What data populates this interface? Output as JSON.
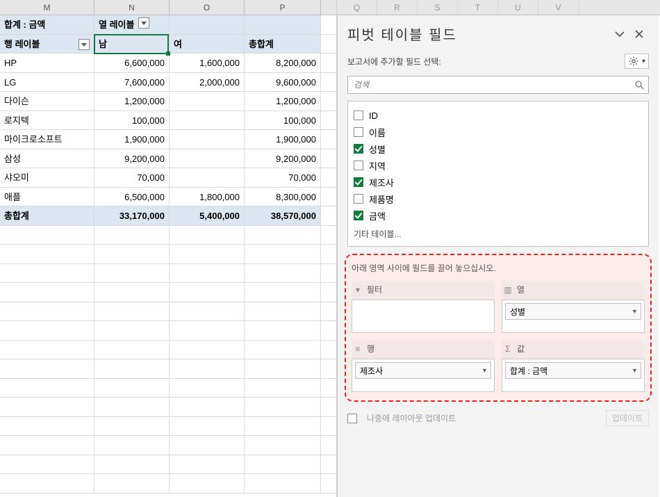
{
  "columns": {
    "M": "M",
    "N": "N",
    "O": "O",
    "P": "P",
    "Q": "Q",
    "R": "R",
    "S": "S",
    "T": "T",
    "U": "U",
    "V": "V"
  },
  "pivot": {
    "corner_label": "합계 : 금액",
    "col_field_label": "열 레이블",
    "row_field_label": "행 레이블",
    "col_headers": {
      "male": "남",
      "female": "여",
      "total": "총합계"
    },
    "rows": [
      {
        "label": "HP",
        "male": "6,600,000",
        "female": "1,600,000",
        "total": "8,200,000"
      },
      {
        "label": "LG",
        "male": "7,600,000",
        "female": "2,000,000",
        "total": "9,600,000"
      },
      {
        "label": "다이슨",
        "male": "1,200,000",
        "female": "",
        "total": "1,200,000"
      },
      {
        "label": "로지텍",
        "male": "100,000",
        "female": "",
        "total": "100,000"
      },
      {
        "label": "마이크로소프트",
        "male": "1,900,000",
        "female": "",
        "total": "1,900,000"
      },
      {
        "label": "삼성",
        "male": "9,200,000",
        "female": "",
        "total": "9,200,000"
      },
      {
        "label": "샤오미",
        "male": "70,000",
        "female": "",
        "total": "70,000"
      },
      {
        "label": "애플",
        "male": "6,500,000",
        "female": "1,800,000",
        "total": "8,300,000"
      }
    ],
    "grand_total": {
      "label": "총합계",
      "male": "33,170,000",
      "female": "5,400,000",
      "total": "38,570,000"
    }
  },
  "pane": {
    "title": "피벗 테이블 필드",
    "subtitle": "보고서에 추가할 필드 선택:",
    "search_placeholder": "검색",
    "fields": [
      {
        "label": "ID",
        "checked": false
      },
      {
        "label": "이름",
        "checked": false
      },
      {
        "label": "성별",
        "checked": true
      },
      {
        "label": "지역",
        "checked": false
      },
      {
        "label": "제조사",
        "checked": true
      },
      {
        "label": "제품명",
        "checked": false
      },
      {
        "label": "금액",
        "checked": true
      }
    ],
    "other_tables": "기타 테이블...",
    "drop_instruction": "아래 영역 사이에 필드를 끌어 놓으십시오.",
    "areas": {
      "filters": {
        "title": "필터",
        "items": []
      },
      "columns": {
        "title": "열",
        "items": [
          "성별"
        ]
      },
      "rows": {
        "title": "행",
        "items": [
          "제조사"
        ]
      },
      "values": {
        "title": "값",
        "items": [
          "합계 : 금액"
        ]
      }
    },
    "defer_label": "나중에 레이아웃 업데이트",
    "update_btn": "업데이트"
  },
  "chart_data": {
    "type": "table",
    "title": "합계 : 금액",
    "row_field": "제조사",
    "col_field": "성별",
    "columns": [
      "남",
      "여",
      "총합계"
    ],
    "rows": [
      {
        "label": "HP",
        "values": [
          6600000,
          1600000,
          8200000
        ]
      },
      {
        "label": "LG",
        "values": [
          7600000,
          2000000,
          9600000
        ]
      },
      {
        "label": "다이슨",
        "values": [
          1200000,
          null,
          1200000
        ]
      },
      {
        "label": "로지텍",
        "values": [
          100000,
          null,
          100000
        ]
      },
      {
        "label": "마이크로소프트",
        "values": [
          1900000,
          null,
          1900000
        ]
      },
      {
        "label": "삼성",
        "values": [
          9200000,
          null,
          9200000
        ]
      },
      {
        "label": "샤오미",
        "values": [
          70000,
          null,
          70000
        ]
      },
      {
        "label": "애플",
        "values": [
          6500000,
          1800000,
          8300000
        ]
      }
    ],
    "grand_total": [
      33170000,
      5400000,
      38570000
    ]
  }
}
